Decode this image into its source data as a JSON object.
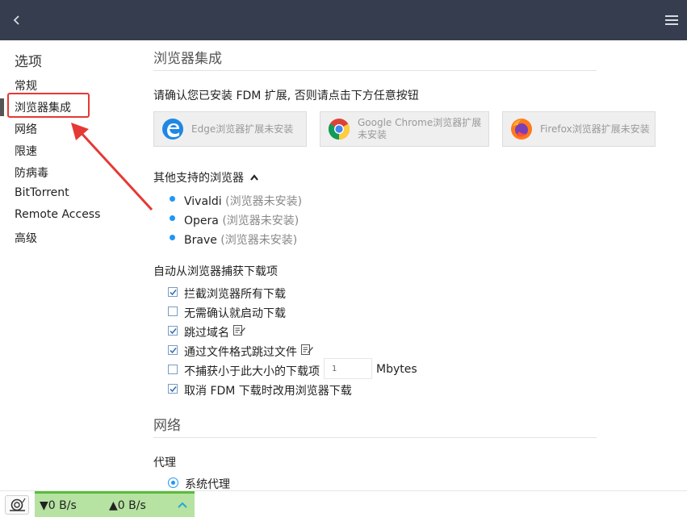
{
  "sidebar": {
    "title": "选项",
    "items": [
      {
        "label": "常规"
      },
      {
        "label": "浏览器集成"
      },
      {
        "label": "网络"
      },
      {
        "label": "限速"
      },
      {
        "label": "防病毒"
      },
      {
        "label": "BitTorrent"
      },
      {
        "label": "Remote Access"
      },
      {
        "label": "高级"
      }
    ],
    "active_index": 1
  },
  "browser_integration": {
    "title": "浏览器集成",
    "prompt": "请确认您已安装 FDM 扩展, 否则请点击下方任意按钮",
    "extensions": [
      {
        "label": "Edge浏览器扩展未安装",
        "icon": "edge-icon"
      },
      {
        "label": "Google Chrome浏览器扩展未安装",
        "icon": "chrome-icon"
      },
      {
        "label": "Firefox浏览器扩展未安装",
        "icon": "firefox-icon"
      }
    ],
    "other_browsers_label": "其他支持的浏览器",
    "other_browsers": [
      {
        "name": "Vivaldi",
        "status": "(浏览器未安装)"
      },
      {
        "name": "Opera",
        "status": "(浏览器未安装)"
      },
      {
        "name": "Brave",
        "status": "(浏览器未安装)"
      }
    ],
    "capture_label": "自动从浏览器捕获下载项",
    "options": [
      {
        "label": "拦截浏览器所有下载",
        "checked": true
      },
      {
        "label": "无需确认就启动下载",
        "checked": false
      },
      {
        "label": "跳过域名",
        "checked": true
      },
      {
        "label": "通过文件格式跳过文件",
        "checked": true
      },
      {
        "label": "不捕获小于此大小的下载项",
        "checked": false
      },
      {
        "label": "取消 FDM 下载时改用浏览器下载",
        "checked": true
      }
    ],
    "min_size_value": "1",
    "min_size_unit": "Mbytes"
  },
  "network": {
    "title": "网络",
    "proxy_label": "代理",
    "proxy_option": "系统代理"
  },
  "status": {
    "download_speed": "0 B/s",
    "upload_speed": "0 B/s"
  },
  "colors": {
    "topbar": "#363d4e",
    "accent": "#2196f3",
    "highlight": "#e53935",
    "status_green": "#b6e2a2"
  }
}
